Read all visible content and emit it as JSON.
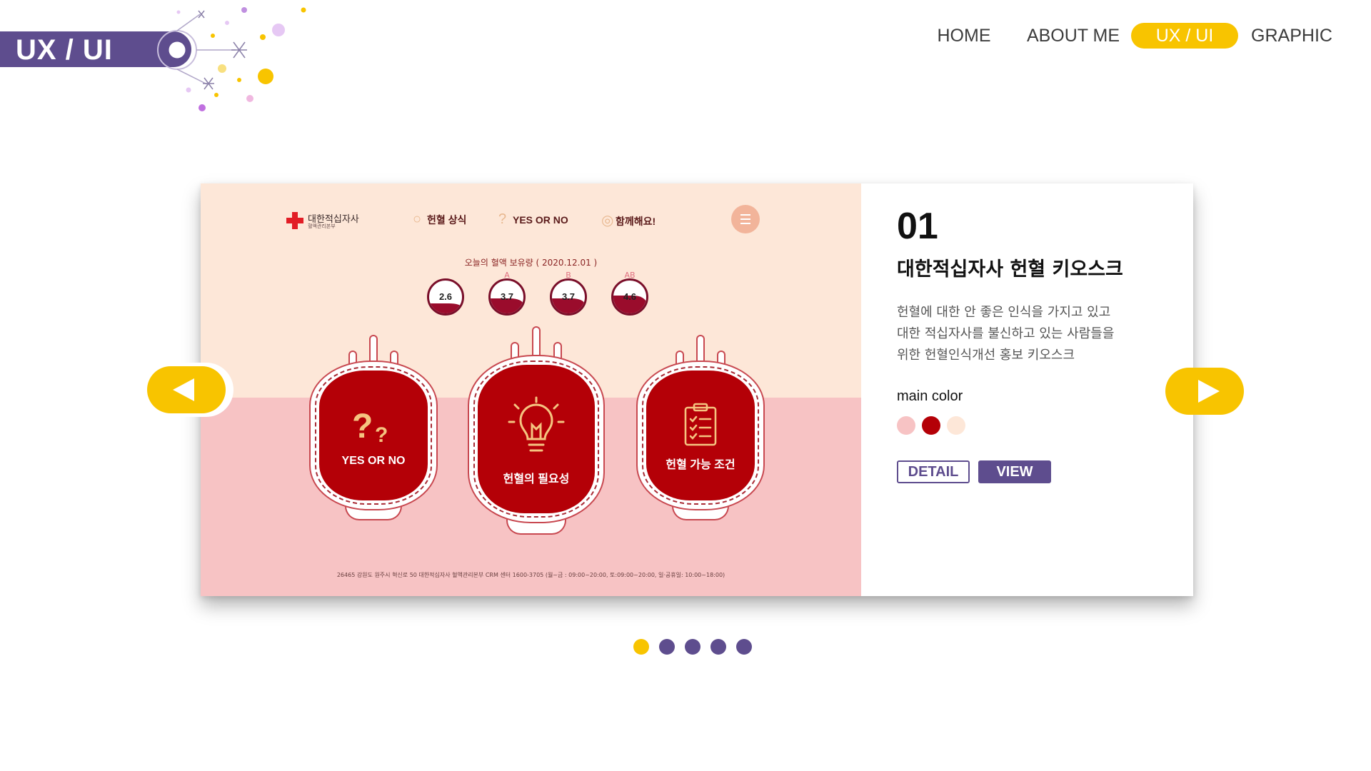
{
  "header": {
    "section_title": "UX / UI"
  },
  "nav": {
    "items": [
      {
        "label": "HOME",
        "active": false
      },
      {
        "label": "ABOUT ME",
        "active": false
      },
      {
        "label": "UX / UI",
        "active": true
      },
      {
        "label": "GRAPHIC",
        "active": false
      }
    ]
  },
  "project": {
    "number": "01",
    "title": "대한적십자사 헌혈 키오스크",
    "description": [
      "헌혈에 대한 안 좋은 인식을 가지고 있고",
      "대한 적십자사를 불신하고 있는 사람들을",
      "위한 헌혈인식개선 홍보 키오스크"
    ],
    "main_color_label": "main color",
    "main_colors": [
      "#f7c3c4",
      "#b40007",
      "#fde7d8"
    ],
    "detail_label": "DETAIL",
    "view_label": "VIEW"
  },
  "preview": {
    "logo_name": "대한적십자사",
    "logo_sub": "혈액관리본부",
    "menu": [
      "헌혈 상식",
      "YES OR NO",
      "함께해요!"
    ],
    "stock_title": "오늘의 혈액 보유량 ( 2020.12.01 )",
    "blood_stock": [
      {
        "type": "",
        "value": "2.6",
        "level": 0.3
      },
      {
        "type": "A",
        "value": "3.7",
        "level": 0.45
      },
      {
        "type": "B",
        "value": "3.7",
        "level": 0.45
      },
      {
        "type": "AB",
        "value": "4.6",
        "level": 0.55
      }
    ],
    "cards": [
      {
        "label": "YES OR NO",
        "icon": "question-icon"
      },
      {
        "label": "헌혈의 필요성",
        "icon": "lightbulb-icon"
      },
      {
        "label": "헌혈 가능 조건",
        "icon": "clipboard-icon"
      }
    ],
    "footer": "26465 강원도 원주시 혁신로 50 대한적십자사 혈액관리본부 CRM 센터 1600-3705  (월~금 : 09:00~20:00, 토:09:00~20:00, 일·공휴일: 10:00~18:00)"
  },
  "carousel": {
    "current_page": 1,
    "total_pages": 5
  },
  "colors": {
    "brand_purple": "#5e4d8e",
    "accent_yellow": "#f8c400",
    "kiosk_red": "#b40007",
    "kiosk_peach": "#fde7d8",
    "kiosk_pink": "#f7c3c4"
  }
}
